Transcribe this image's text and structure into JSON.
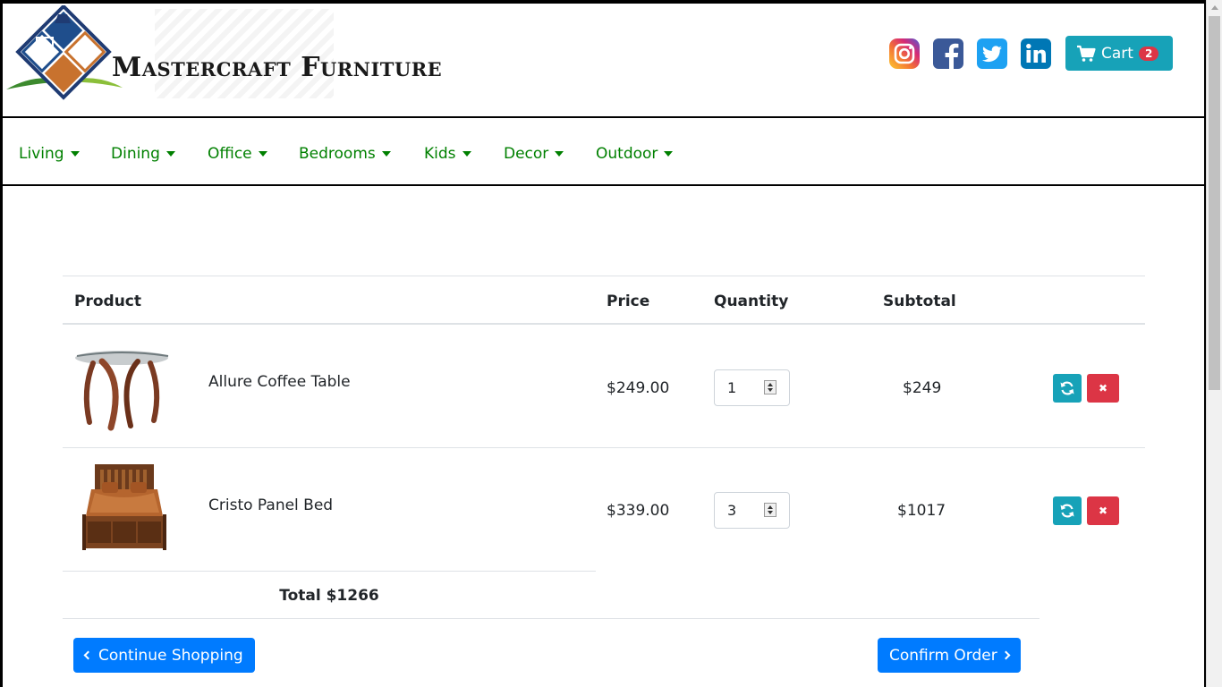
{
  "brand": {
    "name": "Mastercraft Furniture"
  },
  "social": [
    {
      "name": "instagram-icon",
      "color": "#c13584"
    },
    {
      "name": "facebook-icon",
      "color": "#3b5998"
    },
    {
      "name": "twitter-icon",
      "color": "#1da1f2"
    },
    {
      "name": "linkedin-icon",
      "color": "#0077b5"
    }
  ],
  "cart": {
    "label": "Cart",
    "count": "2"
  },
  "nav": {
    "items": [
      {
        "label": "Living"
      },
      {
        "label": "Dining"
      },
      {
        "label": "Office"
      },
      {
        "label": "Bedrooms"
      },
      {
        "label": "Kids"
      },
      {
        "label": "Decor"
      },
      {
        "label": "Outdoor"
      }
    ]
  },
  "table": {
    "headers": {
      "product": "Product",
      "price": "Price",
      "quantity": "Quantity",
      "subtotal": "Subtotal"
    },
    "rows": [
      {
        "name": "Allure Coffee Table",
        "price": "$249.00",
        "quantity": "1",
        "subtotal": "$249"
      },
      {
        "name": "Cristo Panel Bed",
        "price": "$339.00",
        "quantity": "3",
        "subtotal": "$1017"
      }
    ],
    "total": "Total $1266"
  },
  "actions": {
    "continue": "Continue Shopping",
    "confirm": "Confirm Order"
  },
  "colors": {
    "accent": "#17a2b8",
    "danger": "#dc3545",
    "primary": "#007bff",
    "nav": "#008000"
  }
}
